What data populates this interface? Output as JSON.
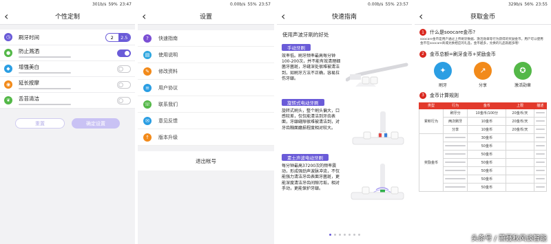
{
  "screens": {
    "custom": {
      "status": {
        "net": "301b/s",
        "battery": "59%",
        "time": "23:47"
      },
      "title": "个性定制",
      "rows": [
        {
          "label": "刷牙时间",
          "type": "segment",
          "options": [
            "2",
            "2.5"
          ],
          "selected": "2.5",
          "icon": "clock-icon",
          "color": "#6a5bd8"
        },
        {
          "label": "防止溅洒",
          "type": "toggle",
          "on": true,
          "icon": "drop-icon",
          "color": "#54b848"
        },
        {
          "label": "增强美白",
          "type": "toggle",
          "on": false,
          "icon": "tooth-icon",
          "color": "#2b9ee3"
        },
        {
          "label": "延长按摩",
          "type": "toggle",
          "on": false,
          "icon": "massage-icon",
          "color": "#f28a1a"
        },
        {
          "label": "舌苔清洁",
          "type": "toggle",
          "on": false,
          "icon": "leaf-icon",
          "color": "#54b848"
        }
      ],
      "reset_label": "重置",
      "confirm_label": "确定设置"
    },
    "settings": {
      "status": {
        "net": "0.00b/s",
        "battery": "55%",
        "time": "23:57"
      },
      "title": "设置",
      "items": [
        {
          "label": "快速指南",
          "icon": "question-icon",
          "color": "#7b4fd4"
        },
        {
          "label": "使用说明",
          "icon": "manual-icon",
          "color": "#2fa7e0"
        },
        {
          "label": "修改资料",
          "icon": "pencil-icon",
          "color": "#f28a1a"
        },
        {
          "label": "用户协议",
          "icon": "document-icon",
          "color": "#2b9ee3"
        },
        {
          "label": "联系我们",
          "icon": "phone-icon",
          "color": "#54b848"
        },
        {
          "label": "意见反馈",
          "icon": "feedback-icon",
          "color": "#2b9ee3"
        },
        {
          "label": "版本升级",
          "icon": "upgrade-icon",
          "color": "#f28a1a"
        }
      ],
      "logout_label": "退出帐号"
    },
    "guide": {
      "status": {
        "net": "0.00b/s",
        "battery": "55%",
        "time": "23:57"
      },
      "title": "快速指南",
      "intro": "使用声波牙刷的好处",
      "sections": [
        {
          "pill": "手动牙刷",
          "text": "效率低。刷牙频率最高每分钟100-200次，并不能有效清理细菌牙菌斑，牙缝深处很难被清洁到，如刷牙方法不正确，容易拉伤牙龈。"
        },
        {
          "pill": "旋转式电动牙刷",
          "text": "旋转式刷头，整个刷头偏大，口感较差，仅仅能清洁到牙齿表面，牙龈缝隙很难被清洁到，对牙齿釉面磨损程度相对较大。"
        },
        {
          "pill": "素士声波电动牙刷",
          "text": "每分钟最高37200次的频率震动，形成强劲声波脉冲流，不仅能强力清洁牙齿表面牙菌斑，更能深度清洁牙齿间隙污垢，相对手动，更能保护牙龈。"
        }
      ],
      "page_count": 7,
      "active_page": 0
    },
    "coins": {
      "status": {
        "net": "329b/s",
        "battery": "56%",
        "time": "23:55"
      },
      "title": "获取金币",
      "sections": [
        {
          "num": "1",
          "title": "什么是soocare金币?"
        },
        {
          "num": "2",
          "title": "金币总额=刷牙金币+奖励金币"
        },
        {
          "num": "3",
          "title": "金币计算规则"
        }
      ],
      "intro": "soocare金币是用户通过上传刷牙数据、激活勋章等行为获得的奖励金币。用户可以使用金币在soocare商城兑换相应的礼品，金币越多，兑换的礼品就越多哦!",
      "actions": [
        {
          "label": "刷牙",
          "icon": "toothbrush-icon",
          "color": "#2b9ee3"
        },
        {
          "label": "分享",
          "icon": "share-icon",
          "color": "#f28a1a"
        },
        {
          "label": "激活勋章",
          "icon": "medal-icon",
          "color": "#54b848"
        }
      ],
      "table": {
        "headers": [
          "类型",
          "行为",
          "金币",
          "上限",
          "描述"
        ],
        "groups": [
          {
            "type": "累积行为",
            "rows": [
              {
                "action": "刷牙分",
                "coin": "10金币/100分",
                "limit": "20金币/天"
              },
              {
                "action": "两次刷牙",
                "coin": "10金币",
                "limit": "20金币/天"
              },
              {
                "action": "分享",
                "coin": "10金币",
                "limit": "20金币/天"
              }
            ]
          },
          {
            "type": "奖励金币",
            "rows": [
              {
                "action": "",
                "coin": "30金币",
                "limit": ""
              },
              {
                "action": "",
                "coin": "50金币",
                "limit": ""
              },
              {
                "action": "",
                "coin": "50金币",
                "limit": ""
              },
              {
                "action": "",
                "coin": "50金币",
                "limit": ""
              },
              {
                "action": "",
                "coin": "50金币",
                "limit": ""
              },
              {
                "action": "",
                "coin": "50金币",
                "limit": ""
              },
              {
                "action": "",
                "coin": "50金币",
                "limit": ""
              }
            ]
          }
        ]
      },
      "watermark": "头条号 / 萧聂秋风谈智能"
    }
  }
}
